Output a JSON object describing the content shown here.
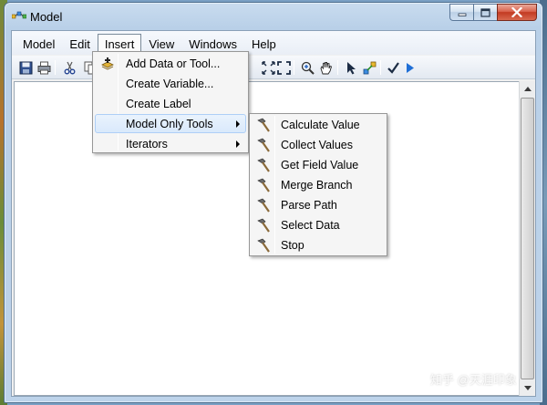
{
  "window": {
    "title": "Model"
  },
  "menubar": {
    "items": [
      {
        "label": "Model"
      },
      {
        "label": "Edit"
      },
      {
        "label": "Insert"
      },
      {
        "label": "View"
      },
      {
        "label": "Windows"
      },
      {
        "label": "Help"
      }
    ],
    "active": "Insert"
  },
  "toolbar": {
    "icons": [
      "save-icon",
      "print-icon",
      "cut-icon",
      "copy-icon",
      "zoom-extent-icon",
      "full-extent-icon",
      "zoom-in-icon",
      "pan-icon",
      "select-icon",
      "connect-icon",
      "validate-icon",
      "run-icon"
    ]
  },
  "insert_menu": {
    "items": [
      {
        "label": "Add Data or Tool...",
        "icon": "add-data-icon",
        "submenu": false
      },
      {
        "label": "Create Variable...",
        "submenu": false
      },
      {
        "label": "Create Label",
        "submenu": false
      },
      {
        "label": "Model Only Tools",
        "submenu": true,
        "highlighted": true
      },
      {
        "label": "Iterators",
        "submenu": true
      }
    ]
  },
  "model_only_tools": {
    "items": [
      {
        "label": "Calculate Value",
        "icon": "hammer-icon"
      },
      {
        "label": "Collect Values",
        "icon": "hammer-icon"
      },
      {
        "label": "Get Field Value",
        "icon": "hammer-icon"
      },
      {
        "label": "Merge Branch",
        "icon": "hammer-icon"
      },
      {
        "label": "Parse Path",
        "icon": "hammer-icon"
      },
      {
        "label": "Select Data",
        "icon": "hammer-icon"
      },
      {
        "label": "Stop",
        "icon": "hammer-icon"
      }
    ]
  },
  "watermark": {
    "text": "知乎 @天涯印象"
  }
}
